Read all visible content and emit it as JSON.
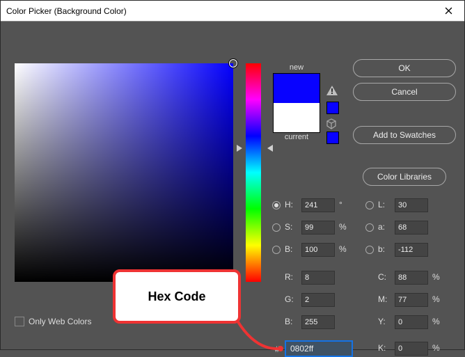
{
  "window": {
    "title": "Color Picker (Background Color)"
  },
  "buttons": {
    "ok": "OK",
    "cancel": "Cancel",
    "add_swatches": "Add to Swatches",
    "libraries": "Color Libraries"
  },
  "preview": {
    "new_label": "new",
    "current_label": "current"
  },
  "checkbox": {
    "only_web": "Only Web Colors"
  },
  "fields": {
    "H": {
      "label": "H:",
      "value": "241",
      "unit": "°"
    },
    "S": {
      "label": "S:",
      "value": "99",
      "unit": "%"
    },
    "Bhsb": {
      "label": "B:",
      "value": "100",
      "unit": "%"
    },
    "L": {
      "label": "L:",
      "value": "30"
    },
    "a": {
      "label": "a:",
      "value": "68"
    },
    "b_lab": {
      "label": "b:",
      "value": "-112"
    },
    "R": {
      "label": "R:",
      "value": "8"
    },
    "G": {
      "label": "G:",
      "value": "2"
    },
    "Brgb": {
      "label": "B:",
      "value": "255"
    },
    "C": {
      "label": "C:",
      "value": "88",
      "unit": "%"
    },
    "M": {
      "label": "M:",
      "value": "77",
      "unit": "%"
    },
    "Y": {
      "label": "Y:",
      "value": "0",
      "unit": "%"
    },
    "K": {
      "label": "K:",
      "value": "0",
      "unit": "%"
    }
  },
  "hex": {
    "hash": "#",
    "value": "0802ff"
  },
  "annotation": {
    "label": "Hex Code"
  },
  "colors": {
    "selected_hex": "#0802ff"
  }
}
